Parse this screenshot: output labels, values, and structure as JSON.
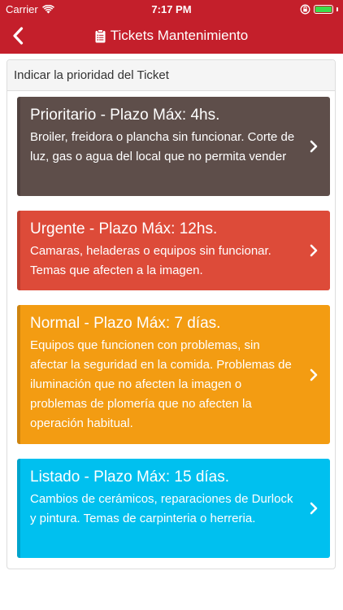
{
  "status_bar": {
    "carrier": "Carrier",
    "time": "7:17 PM"
  },
  "nav": {
    "title": "Tickets Mantenimiento"
  },
  "panel": {
    "heading": "Indicar la prioridad del Ticket"
  },
  "priorities": [
    {
      "title": "Prioritario - Plazo Máx: 4hs.",
      "description": "Broiler, freidora o plancha sin funcionar. Corte de luz, gas o agua del local que no permita vender",
      "color": "#5e4e4a"
    },
    {
      "title": "Urgente - Plazo Máx: 12hs.",
      "description": "Camaras, heladeras o equipos sin funcionar. Temas que afecten a la imagen.",
      "color": "#dd4b39"
    },
    {
      "title": "Normal - Plazo Máx: 7 días.",
      "description": "Equipos que funcionen con problemas, sin afectar la seguridad en la comida. Problemas de iluminación que no afecten la imagen o problemas de plomería que no afecten la operación habitual.",
      "color": "#f39c12"
    },
    {
      "title": "Listado - Plazo Máx: 15 días.",
      "description": "Cambios de cerámicos, reparaciones de Durlock y pintura. Temas de carpinteria o herreria.",
      "color": "#00c0ef"
    }
  ]
}
